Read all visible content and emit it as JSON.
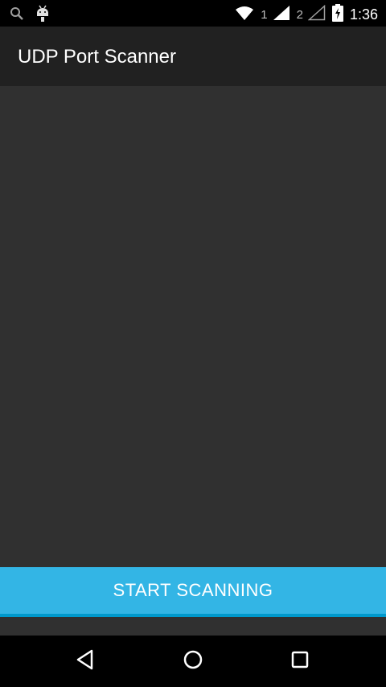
{
  "status_bar": {
    "left_icons": [
      "search-icon",
      "android-debug-icon"
    ],
    "wifi_icon": "wifi-icon",
    "sim1_label": "1",
    "sim2_label": "2",
    "battery_icon": "battery-charging-icon",
    "time": "1:36"
  },
  "app_bar": {
    "title": "UDP Port Scanner"
  },
  "main": {
    "scan_button_label": "START SCANNING"
  },
  "nav_bar": {
    "back_icon": "back-icon",
    "home_icon": "home-icon",
    "recents_icon": "recents-icon"
  },
  "colors": {
    "status_bar_bg": "#000000",
    "app_bar_bg": "#212121",
    "content_bg": "#303030",
    "accent": "#33b5e5",
    "accent_dark": "#0099cc"
  }
}
